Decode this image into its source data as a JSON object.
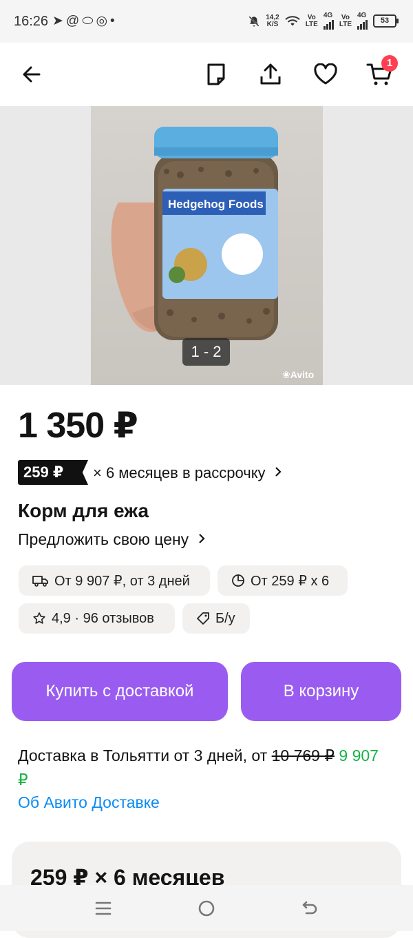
{
  "status_bar": {
    "time": "16:26",
    "speed_value": "14,2",
    "speed_unit": "K/S",
    "volte1_top": "Vo",
    "volte1_bottom": "LTE",
    "net1": "4G",
    "volte2_top": "Vo",
    "volte2_bottom": "LTE",
    "net2": "4G",
    "battery": "53"
  },
  "top_nav": {
    "cart_count": "1"
  },
  "gallery": {
    "counter": "1 - 2",
    "watermark": "Avito",
    "product_label": "Hedgehog Foods"
  },
  "listing": {
    "price": "1 350 ₽",
    "installment_badge": "259 ₽",
    "installment_text": "× 6 месяцев в рассрочку",
    "title": "Корм для ежа",
    "offer_price": "Предложить свою цену"
  },
  "chips": {
    "delivery": "От 9 907 ₽, от 3 дней",
    "installment": "От 259 ₽ x 6",
    "rating": "4,9 · 96 отзывов",
    "condition": "Б/у"
  },
  "buttons": {
    "buy_delivery": "Купить с доставкой",
    "add_to_cart": "В корзину"
  },
  "delivery_info": {
    "text": "Доставка в Тольятти от 3 дней, от",
    "old_price": "10 769 ₽",
    "new_price": "9 907 ₽",
    "link": "Об Авито Доставке"
  },
  "installment_card": {
    "title": "259 ₽ × 6 месяцев"
  },
  "colors": {
    "accent": "#9a5cf0",
    "badge": "#ff4053",
    "link": "#0a8bf5",
    "discount": "#17b345"
  }
}
